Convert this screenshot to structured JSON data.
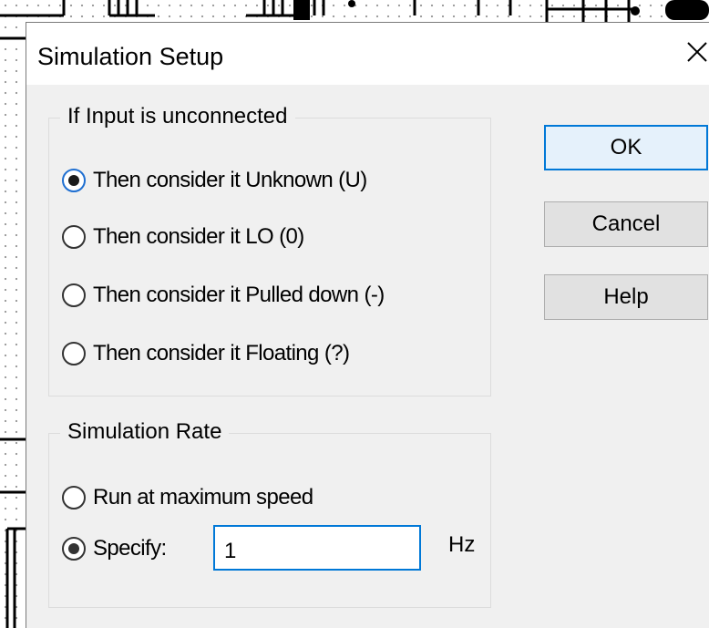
{
  "dialog": {
    "title": "Simulation Setup",
    "close_icon": "close-icon"
  },
  "unconnected_group": {
    "legend": "If Input is unconnected",
    "options": [
      {
        "label": "Then consider it Unknown (U)",
        "selected": true
      },
      {
        "label": "Then consider it LO (0)",
        "selected": false
      },
      {
        "label": "Then consider it Pulled down (-)",
        "selected": false
      },
      {
        "label": "Then consider it Floating (?)",
        "selected": false
      }
    ]
  },
  "rate_group": {
    "legend": "Simulation Rate",
    "options": [
      {
        "label": "Run at maximum speed",
        "selected": false
      },
      {
        "label": "Specify:",
        "selected": true
      }
    ],
    "specify_value": "1",
    "unit": "Hz"
  },
  "buttons": {
    "ok": "OK",
    "cancel": "Cancel",
    "help": "Help"
  },
  "colors": {
    "dialog_bg": "#f0f0f0",
    "focus_blue": "#0078d7",
    "default_button_bg": "#e5f1fb"
  }
}
